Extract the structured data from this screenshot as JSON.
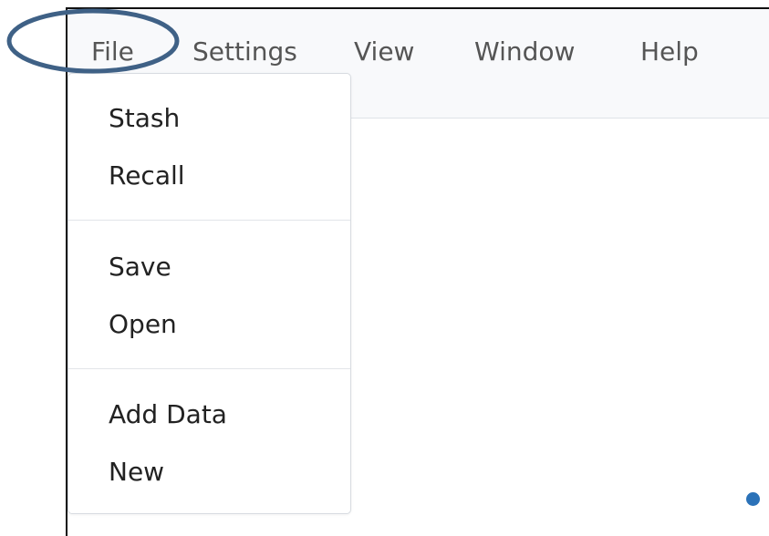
{
  "menubar": {
    "items": [
      {
        "label": "File"
      },
      {
        "label": "Settings"
      },
      {
        "label": "View"
      },
      {
        "label": "Window"
      },
      {
        "label": "Help"
      }
    ]
  },
  "file_menu": {
    "groups": [
      {
        "items": [
          {
            "label": "Stash"
          },
          {
            "label": "Recall"
          }
        ]
      },
      {
        "items": [
          {
            "label": "Save"
          },
          {
            "label": "Open"
          }
        ]
      },
      {
        "items": [
          {
            "label": "Add Data"
          },
          {
            "label": "New"
          }
        ]
      }
    ]
  },
  "annotation": {
    "highlight_color": "#3f6186"
  },
  "colors": {
    "menubar_bg": "#f8f9fb",
    "menu_text": "#555555",
    "dropdown_text": "#222222",
    "status_dot": "#2b72b8"
  }
}
